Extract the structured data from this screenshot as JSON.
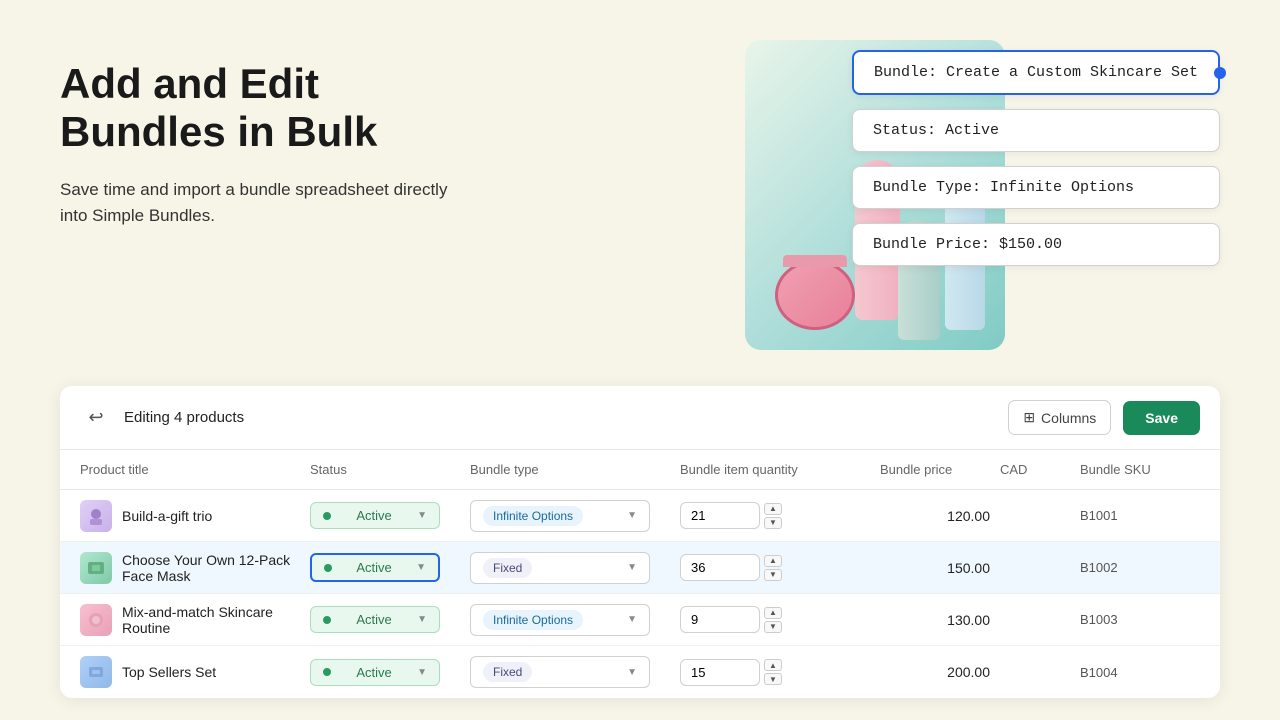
{
  "page": {
    "background": "#f7f5e8"
  },
  "hero": {
    "title_line1": "Add and Edit",
    "title_line2": "Bundles in Bulk",
    "subtitle": "Save time and import a bundle spreadsheet directly into Simple Bundles."
  },
  "info_cards": [
    {
      "id": "bundle-name-card",
      "text": "Bundle: Create a Custom Skincare Set",
      "highlighted": true
    },
    {
      "id": "status-card",
      "text": "Status: Active",
      "highlighted": false
    },
    {
      "id": "type-card",
      "text": "Bundle Type: Infinite Options",
      "highlighted": false
    },
    {
      "id": "price-card",
      "text": "Bundle Price: $150.00",
      "highlighted": false
    }
  ],
  "toolbar": {
    "editing_label": "Editing 4 products",
    "columns_label": "Columns",
    "save_label": "Save"
  },
  "table": {
    "headers": [
      {
        "id": "col-product-title",
        "label": "Product title"
      },
      {
        "id": "col-status",
        "label": "Status"
      },
      {
        "id": "col-bundle-type",
        "label": "Bundle type"
      },
      {
        "id": "col-bundle-qty",
        "label": "Bundle item quantity"
      },
      {
        "id": "col-bundle-price",
        "label": "Bundle price"
      },
      {
        "id": "col-currency",
        "label": "CAD"
      },
      {
        "id": "col-sku",
        "label": "Bundle SKU"
      }
    ],
    "rows": [
      {
        "id": "row-1",
        "thumb_color": "purple",
        "product_name": "Build-a-gift trio",
        "status": "Active",
        "status_active": true,
        "bundle_type": "Infinite Options",
        "bundle_type_style": "infinite",
        "quantity": "21",
        "price": "120.00",
        "sku": "B1001",
        "highlighted": false
      },
      {
        "id": "row-2",
        "thumb_color": "green",
        "product_name": "Choose Your Own 12-Pack Face Mask",
        "status": "Active",
        "status_active": true,
        "bundle_type": "Fixed",
        "bundle_type_style": "fixed",
        "quantity": "36",
        "price": "150.00",
        "sku": "B1002",
        "highlighted": true
      },
      {
        "id": "row-3",
        "thumb_color": "pink",
        "product_name": "Mix-and-match Skincare Routine",
        "status": "Active",
        "status_active": true,
        "bundle_type": "Infinite Options",
        "bundle_type_style": "infinite",
        "quantity": "9",
        "price": "130.00",
        "sku": "B1003",
        "highlighted": false
      },
      {
        "id": "row-4",
        "thumb_color": "blue",
        "product_name": "Top Sellers Set",
        "status": "Active",
        "status_active": true,
        "bundle_type": "Fixed",
        "bundle_type_style": "fixed",
        "quantity": "15",
        "price": "200.00",
        "sku": "B1004",
        "highlighted": false
      }
    ]
  }
}
